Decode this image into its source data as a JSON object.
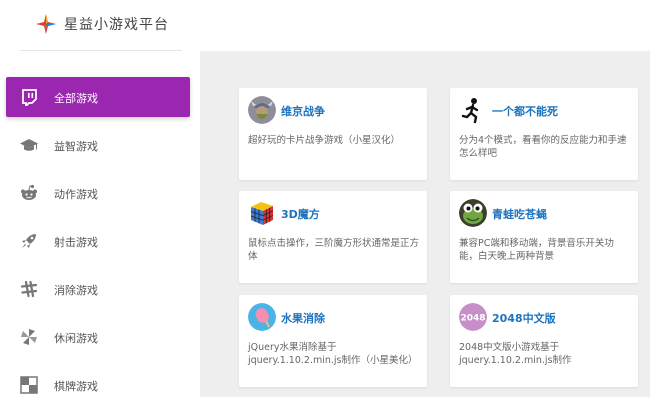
{
  "app": {
    "title": "星益小游戏平台"
  },
  "nav": {
    "items": [
      {
        "label": "全部游戏",
        "icon": "twitch-icon"
      },
      {
        "label": "益智游戏",
        "icon": "graduation-cap-icon"
      },
      {
        "label": "动作游戏",
        "icon": "reddit-icon"
      },
      {
        "label": "射击游戏",
        "icon": "rocket-icon"
      },
      {
        "label": "消除游戏",
        "icon": "slack-icon"
      },
      {
        "label": "休闲游戏",
        "icon": "pinwheel-icon"
      },
      {
        "label": "棋牌游戏",
        "icon": "checkerboard-icon"
      }
    ],
    "active_index": 0
  },
  "games": [
    {
      "title": "维京战争",
      "desc": "超好玩的卡片战争游戏（小星汉化）",
      "icon": "viking-icon"
    },
    {
      "title": "一个都不能死",
      "desc": "分为4个模式，看看你的反应能力和手速怎么样吧",
      "icon": "running-man-icon"
    },
    {
      "title": "3D魔方",
      "desc": "鼠标点击操作，三阶魔方形状通常是正方体",
      "icon": "rubiks-cube-icon"
    },
    {
      "title": "青蛙吃苍蝇",
      "desc": "兼容PC端和移动端，背景音乐开关功能，白天晚上两种背景",
      "icon": "frog-icon"
    },
    {
      "title": "水果消除",
      "desc": "jQuery水果消除基于jquery.1.10.2.min.js制作（小星美化）",
      "icon": "popsicle-icon"
    },
    {
      "title": "2048中文版",
      "desc": "2048中文版小游戏基于jquery.1.10.2.min.js制作",
      "icon": "2048-icon",
      "badge": "2048"
    }
  ],
  "colors": {
    "accent": "#9b27b0",
    "link": "#1e73be",
    "bg": "#eeeeee"
  }
}
